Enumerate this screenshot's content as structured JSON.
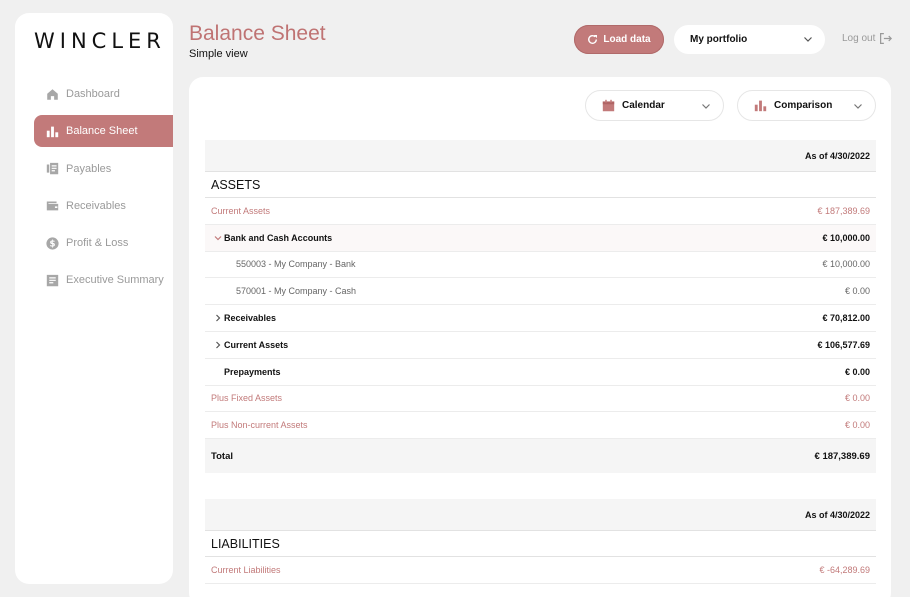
{
  "app": {
    "logo": "WINCLER"
  },
  "sidebar": {
    "items": [
      {
        "label": "Dashboard",
        "icon": "home-icon"
      },
      {
        "label": "Balance Sheet",
        "icon": "bar-chart-icon"
      },
      {
        "label": "Payables",
        "icon": "invoice-icon"
      },
      {
        "label": "Receivables",
        "icon": "wallet-icon"
      },
      {
        "label": "Profit & Loss",
        "icon": "dollar-icon"
      },
      {
        "label": "Executive Summary",
        "icon": "document-icon"
      }
    ],
    "active_index": 1
  },
  "header": {
    "title": "Balance Sheet",
    "subtitle": "Simple view",
    "load_label": "Load data",
    "portfolio_value": "My portfolio",
    "logout_label": "Log out"
  },
  "filters": {
    "calendar_label": "Calendar",
    "comparison_label": "Comparison"
  },
  "assets": {
    "as_of": "As of 4/30/2022",
    "title": "ASSETS",
    "rows": [
      {
        "label": "Current Assets",
        "value": "€ 187,389.69"
      },
      {
        "label": "Bank and Cash Accounts",
        "value": "€ 10,000.00"
      },
      {
        "label": "550003 - My Company - Bank",
        "value": "€ 10,000.00"
      },
      {
        "label": "570001 - My Company - Cash",
        "value": "€ 0.00"
      },
      {
        "label": "Receivables",
        "value": "€ 70,812.00"
      },
      {
        "label": "Current Assets",
        "value": "€ 106,577.69"
      },
      {
        "label": "Prepayments",
        "value": "€ 0.00"
      },
      {
        "label": "Plus Fixed Assets",
        "value": "€ 0.00"
      },
      {
        "label": "Plus Non-current Assets",
        "value": "€ 0.00"
      }
    ],
    "total_label": "Total",
    "total_value": "€ 187,389.69"
  },
  "liabilities": {
    "as_of": "As of 4/30/2022",
    "title": "LIABILITIES",
    "rows": [
      {
        "label": "Current Liabilities",
        "value": "€ -64,289.69"
      }
    ]
  },
  "colors": {
    "accent": "#c27a7a",
    "background": "#f0f0f0"
  }
}
